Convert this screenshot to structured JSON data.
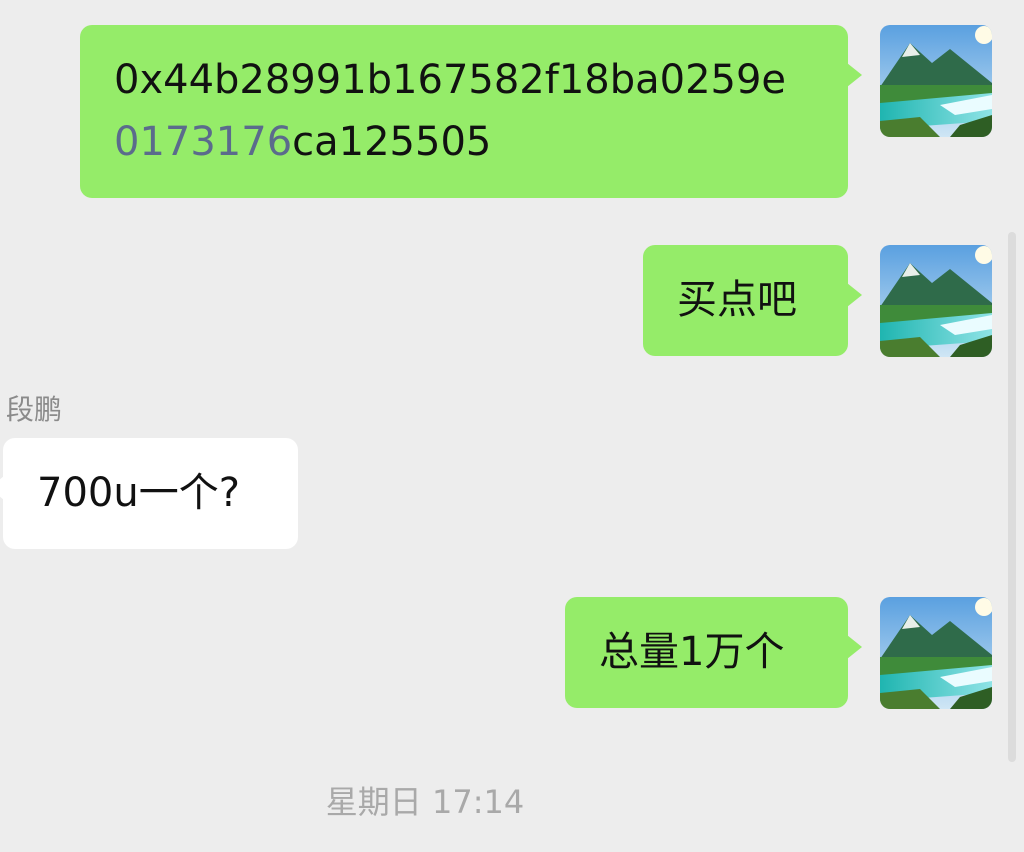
{
  "chat": {
    "messages": [
      {
        "direction": "outgoing",
        "text_line1": "0x44b28991b167582f18ba0259e",
        "text_line2_link": "0173176",
        "text_line2_rest": "ca125505"
      },
      {
        "direction": "outgoing",
        "text": "买点吧"
      },
      {
        "direction": "incoming",
        "sender": "段鹏",
        "text": "700u一个?"
      },
      {
        "direction": "outgoing",
        "text": "总量1万个"
      }
    ],
    "timestamp": "星期日 17:14"
  },
  "colors": {
    "background": "#ededed",
    "outgoing_bubble": "#95ec69",
    "incoming_bubble": "#ffffff",
    "link_digits": "#5b6b8c"
  },
  "icons": {
    "avatar": "mountain-lake-landscape-avatar"
  }
}
